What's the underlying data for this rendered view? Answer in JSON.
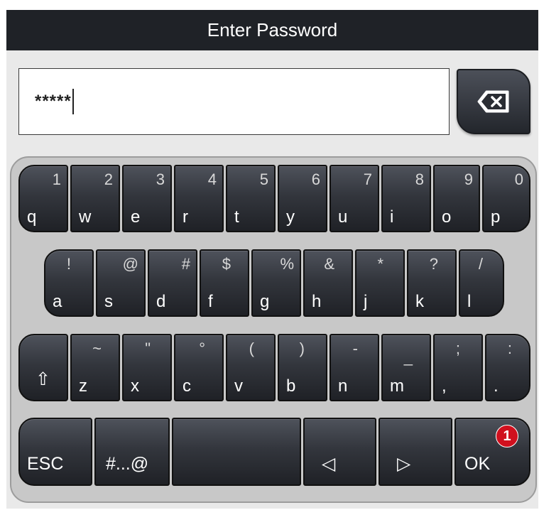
{
  "title": "Enter Password",
  "password": {
    "masked_value": "*****"
  },
  "icons": {
    "backspace": "backspace-icon",
    "shift": "shift-icon",
    "left": "left-arrow-icon",
    "right": "right-arrow-icon"
  },
  "keyboard": {
    "row1": [
      {
        "top": "1",
        "main": "q"
      },
      {
        "top": "2",
        "main": "w"
      },
      {
        "top": "3",
        "main": "e"
      },
      {
        "top": "4",
        "main": "r"
      },
      {
        "top": "5",
        "main": "t"
      },
      {
        "top": "6",
        "main": "y"
      },
      {
        "top": "7",
        "main": "u"
      },
      {
        "top": "8",
        "main": "i"
      },
      {
        "top": "9",
        "main": "o"
      },
      {
        "top": "0",
        "main": "p"
      }
    ],
    "row2": [
      {
        "top": "!",
        "main": "a"
      },
      {
        "top": "@",
        "main": "s"
      },
      {
        "top": "#",
        "main": "d"
      },
      {
        "top": "$",
        "main": "f"
      },
      {
        "top": "%",
        "main": "g"
      },
      {
        "top": "&",
        "main": "h"
      },
      {
        "top": "*",
        "main": "j"
      },
      {
        "top": "?",
        "main": "k"
      },
      {
        "top": "/",
        "main": "l"
      }
    ],
    "row3": [
      {
        "top": "~",
        "main": "z"
      },
      {
        "top": "\"",
        "main": "x"
      },
      {
        "top": "°",
        "main": "c"
      },
      {
        "top": "(",
        "main": "v"
      },
      {
        "top": ")",
        "main": "b"
      },
      {
        "top": "-",
        "main": "n"
      },
      {
        "top": "_",
        "main": "m"
      },
      {
        "top": ";",
        "main": ","
      },
      {
        "top": ":",
        "main": "."
      }
    ],
    "row4": {
      "esc": "ESC",
      "symbols": "#...@",
      "left": "◁",
      "right": "▷",
      "ok": "OK"
    },
    "shift": "⇧"
  },
  "badge": "1",
  "colors": {
    "key": "#33363d",
    "titlebar": "#1f2227",
    "badge": "#d0101e"
  }
}
